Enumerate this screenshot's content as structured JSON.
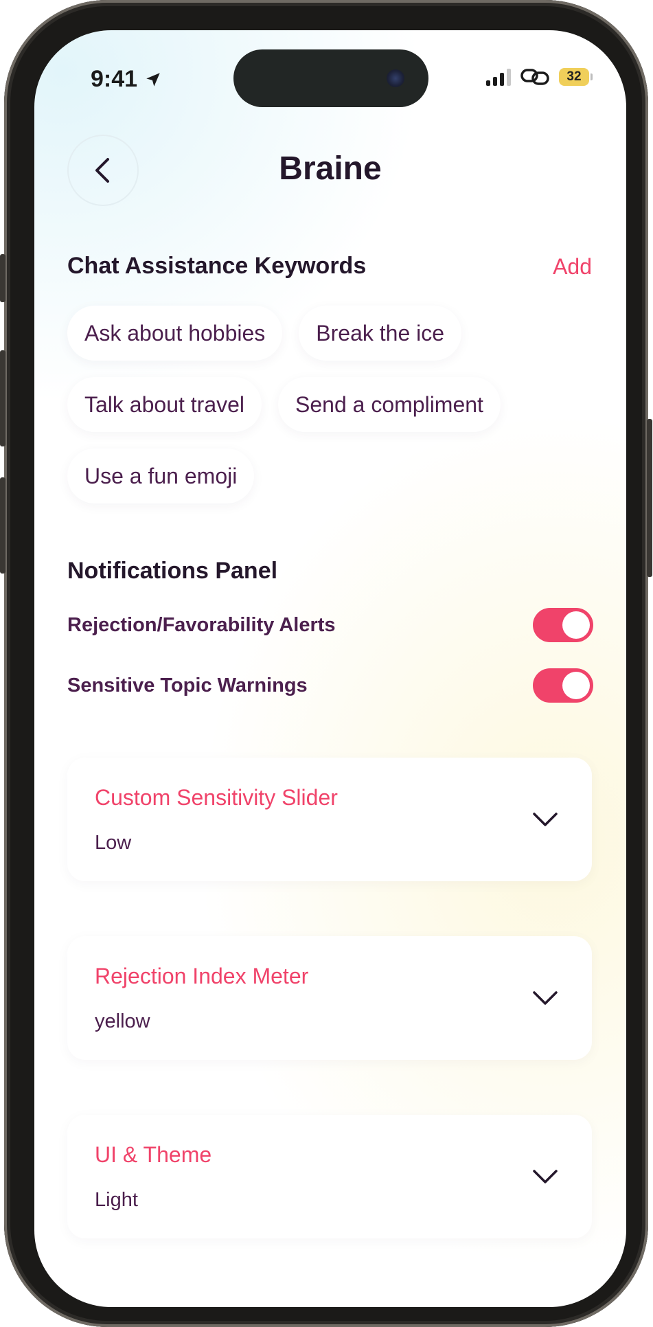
{
  "status_bar": {
    "time": "9:41",
    "battery": "32"
  },
  "header": {
    "title": "Braine"
  },
  "keywords": {
    "title": "Chat Assistance Keywords",
    "add_label": "Add",
    "chips": [
      "Ask about hobbies",
      "Break the ice",
      "Talk about travel",
      "Send a compliment",
      "Use a fun emoji"
    ]
  },
  "notifications": {
    "title": "Notifications Panel",
    "toggles": [
      {
        "label": "Rejection/Favorability Alerts",
        "on": true
      },
      {
        "label": "Sensitive Topic Warnings",
        "on": true
      }
    ]
  },
  "cards": [
    {
      "title": "Custom Sensitivity Slider",
      "value": "Low"
    },
    {
      "title": "Rejection Index Meter",
      "value": "yellow"
    },
    {
      "title": "UI & Theme",
      "value": "Light"
    }
  ],
  "colors": {
    "accent": "#f0436a",
    "text_dark": "#24172b",
    "text_purple": "#4b1f4d"
  }
}
